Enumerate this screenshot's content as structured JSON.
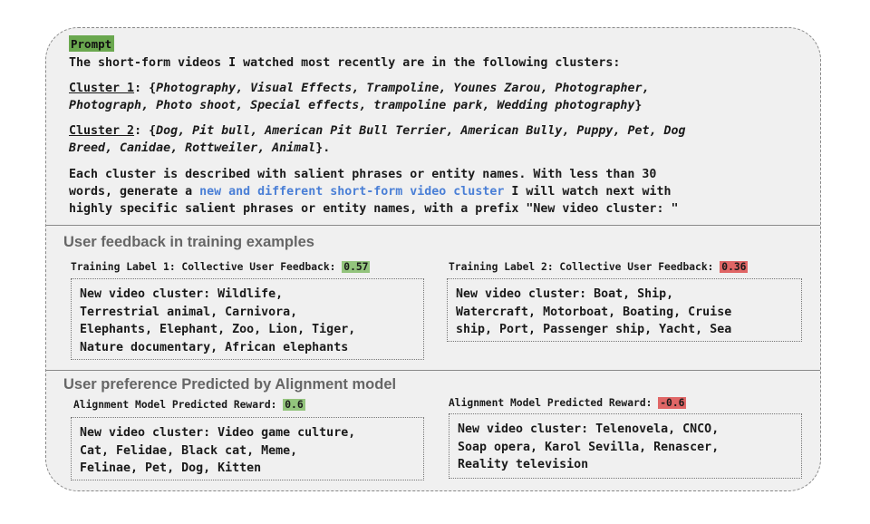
{
  "prompt": {
    "tag": "Prompt",
    "intro": "The short-form videos I watched most recently are in the following clusters:",
    "cluster1": {
      "label": "Cluster 1",
      "line1_prefix": ": {",
      "line1_items": "Photography, Visual Effects, Trampoline, Younes Zarou, Photographer,",
      "line2_items": "Photograph, Photo shoot, Special effects, trampoline park, Wedding photography",
      "line2_suffix": "}"
    },
    "cluster2": {
      "label": "Cluster 2",
      "line1_prefix": ": {",
      "line1_items": "Dog, Pit bull, American Pit Bull Terrier, American Bully, Puppy, Pet, Dog",
      "line2_items": "Breed, Canidae, Rottweiler, Animal",
      "line2_suffix": "}."
    },
    "instruction_line1": "Each cluster is described with salient phrases or entity names. With less than 30",
    "instruction_line2_pre": "words, generate a ",
    "instruction_line2_highlight": "new and different short-form video cluster",
    "instruction_line2_post": " I will watch next with",
    "instruction_line3": "highly specific salient phrases or entity names, with a prefix \"New video cluster: \""
  },
  "feedback": {
    "title": "User feedback in training examples",
    "label1_text": "Training Label 1: Collective User Feedback: ",
    "label1_value": "0.57",
    "label2_text": "Training Label 2: Collective User Feedback: ",
    "label2_value": "0.36",
    "box1_lines": [
      "New video cluster: Wildlife,",
      "Terrestrial animal, Carnivora,",
      "Elephants, Elephant, Zoo, Lion, Tiger,",
      "Nature documentary, African elephants"
    ],
    "box2_lines": [
      "New video cluster: Boat, Ship,",
      "Watercraft, Motorboat, Boating, Cruise",
      "ship, Port, Passenger ship, Yacht, Sea"
    ]
  },
  "alignment": {
    "title": "User preference Predicted by Alignment model",
    "label1_text": "Alignment Model Predicted Reward: ",
    "label1_value": "0.6",
    "label2_text": "Alignment Model Predicted Reward: ",
    "label2_value": "-0.6",
    "box1_lines": [
      "New video cluster: Video game culture,",
      "Cat, Felidae, Black cat, Meme,",
      "Felinae, Pet, Dog, Kitten"
    ],
    "box2_lines": [
      "New video cluster: Telenovela, CNCO,",
      "Soap opera, Karol Sevilla, Renascer,",
      "Reality television"
    ]
  },
  "colors": {
    "panel_bg": "#f0f0f0",
    "positive": "#93c47d",
    "negative": "#e06666",
    "highlight_text": "#4a7fd6"
  }
}
